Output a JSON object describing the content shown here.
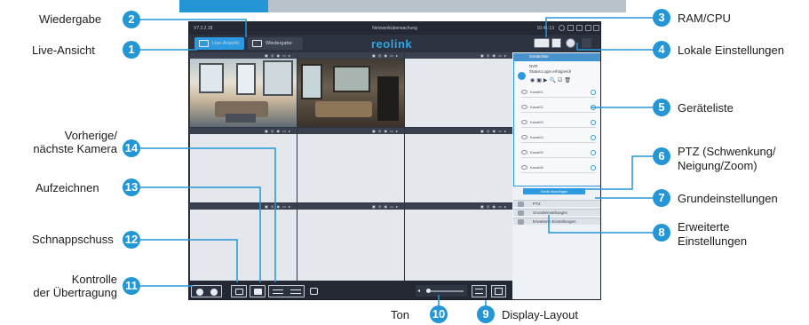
{
  "app": {
    "version": "V7.2.2.18",
    "title": "Netzwerküberwachung",
    "clock": "10:41:13",
    "logo": "reolink",
    "tabs": [
      {
        "label": "Live-Ansicht",
        "active": true
      },
      {
        "label": "Wiedergabe",
        "active": false
      }
    ],
    "accent_color": "#2496d6"
  },
  "device_panel": {
    "header": "Geräteliste",
    "device_name": "NVR",
    "device_status": "Status:Login erfolgreich",
    "channels": [
      "Kanal01",
      "Kanal02",
      "Kanal03",
      "Kanal04",
      "Kanal05",
      "Kanal06"
    ],
    "add_button": "Gerät hinzufügen",
    "sections": [
      "PTZ",
      "Grundeinstellungen",
      "Erweiterte Einstellungen"
    ]
  },
  "callouts": [
    {
      "num": "1",
      "label": "Live-Ansicht"
    },
    {
      "num": "2",
      "label": "Wiedergabe"
    },
    {
      "num": "3",
      "label": "RAM/CPU"
    },
    {
      "num": "4",
      "label": "Lokale Einstellungen"
    },
    {
      "num": "5",
      "label": "Geräteliste"
    },
    {
      "num": "6",
      "label_l1": "PTZ (Schwenkung/",
      "label_l2": "Neigung/Zoom)"
    },
    {
      "num": "7",
      "label": "Grundeinstellungen"
    },
    {
      "num": "8",
      "label_l1": "Erweiterte",
      "label_l2": "Einstellungen"
    },
    {
      "num": "9",
      "label": "Display-Layout"
    },
    {
      "num": "10",
      "label": "Ton"
    },
    {
      "num": "11",
      "label_l1": "Kontrolle",
      "label_l2": "der Übertragung"
    },
    {
      "num": "12",
      "label": "Schnappschuss"
    },
    {
      "num": "13",
      "label": "Aufzeichnen"
    },
    {
      "num": "14",
      "label_l1": "Vorherige/",
      "label_l2": "nächste Kamera"
    }
  ]
}
